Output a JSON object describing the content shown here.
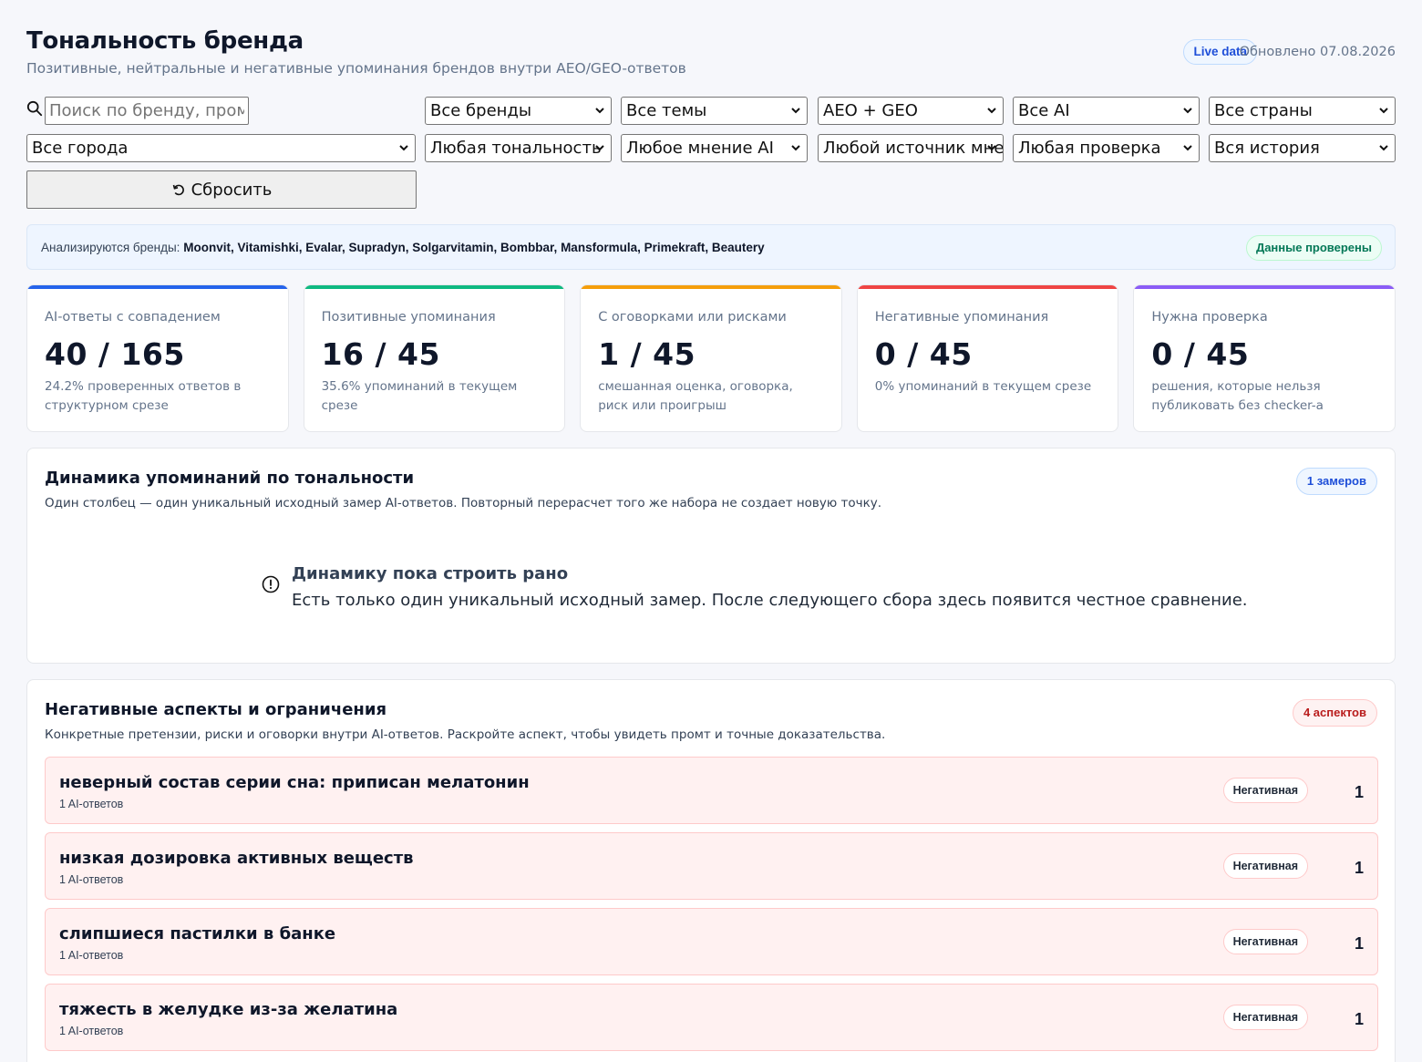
{
  "header": {
    "title": "Тональность бренда",
    "subtitle": "Позитивные, нейтральные и негативные упоминания брендов внутри AEO/GEO-ответов",
    "live_badge": "Live data",
    "updated": "Обновлено 07.08.2026"
  },
  "filters": {
    "search_placeholder": "Поиск по бренду, промт",
    "row1": [
      "Все бренды",
      "Все темы",
      "AEO + GEO",
      "Все AI",
      "Все страны"
    ],
    "row2_city": "Все города",
    "row2": [
      "Любая тональность",
      "Любое мнение AI",
      "Любой источник мнен",
      "Любая проверка",
      "Вся история"
    ],
    "reset_label": "Сбросить"
  },
  "brands": {
    "prefix": "Анализируются бренды:",
    "list": "Moonvit, Vitamishki, Evalar, Supradyn, Solgarvitamin, Bombbar, Mansformula, Primekraft, Beautery",
    "verified": "Данные проверены"
  },
  "cards": [
    {
      "label": "AI-ответы с совпадением",
      "value": "40 / 165",
      "note": "24.2% проверенных ответов в структурном срезе",
      "color": "#2563eb"
    },
    {
      "label": "Позитивные упоминания",
      "value": "16 / 45",
      "note": "35.6% упоминаний в текущем срезе",
      "color": "#10b981"
    },
    {
      "label": "С оговорками или рисками",
      "value": "1 / 45",
      "note": "смешанная оценка, оговорка, риск или проигрыш",
      "color": "#f59e0b"
    },
    {
      "label": "Негативные упоминания",
      "value": "0 / 45",
      "note": "0% упоминаний в текущем срезе",
      "color": "#ef4444"
    },
    {
      "label": "Нужна проверка",
      "value": "0 / 45",
      "note": "решения, которые нельзя публиковать без checker-а",
      "color": "#8b5cf6"
    }
  ],
  "dynamics": {
    "title": "Динамика упоминаний по тональности",
    "description": "Один столбец — один уникальный исходный замер AI-ответов. Повторный перерасчет того же набора не создает новую точку.",
    "badge": "1 замеров",
    "empty_title": "Динамику пока строить рано",
    "empty_text": "Есть только один уникальный исходный замер. После следующего сбора здесь появится честное сравнение."
  },
  "aspects": {
    "title": "Негативные аспекты и ограничения",
    "description": "Конкретные претензии, риски и оговорки внутри AI-ответов. Раскройте аспект, чтобы увидеть промт и точные доказательства.",
    "badge": "4 аспектов",
    "items": [
      {
        "title": "неверный состав серии сна: приписан мелатонин",
        "count": "1 AI-ответов",
        "tone": "Негативная",
        "num": "1"
      },
      {
        "title": "низкая дозировка активных веществ",
        "count": "1 AI-ответов",
        "tone": "Негативная",
        "num": "1"
      },
      {
        "title": "слипшиеся пастилки в банке",
        "count": "1 AI-ответов",
        "tone": "Негативная",
        "num": "1"
      },
      {
        "title": "тяжесть в желудке из-за желатина",
        "count": "1 AI-ответов",
        "tone": "Негативная",
        "num": "1"
      }
    ]
  }
}
